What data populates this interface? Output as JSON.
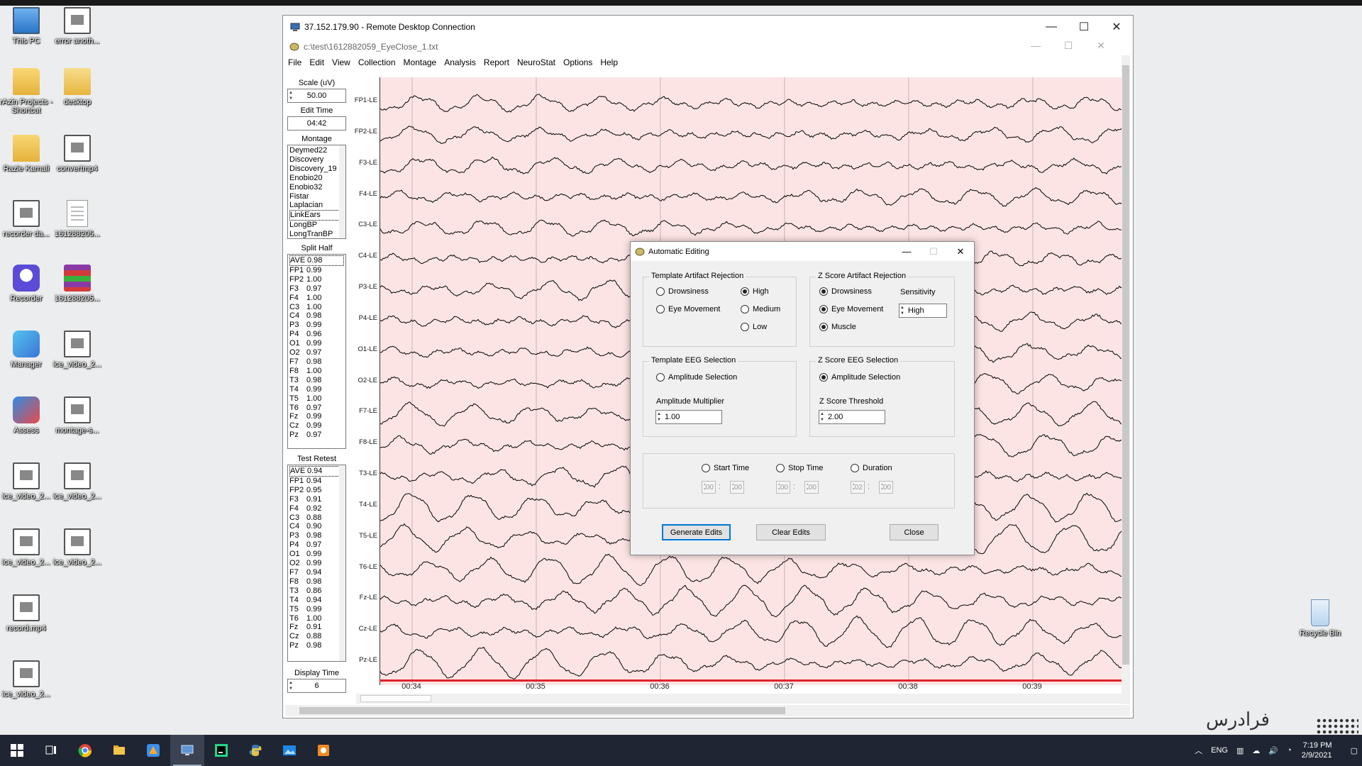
{
  "desktop": {
    "icons": [
      {
        "label": "This PC",
        "type": "pc"
      },
      {
        "label": "error anoth...",
        "type": "video"
      },
      {
        "label": "rAzin Projects - Shortcut",
        "type": "folder"
      },
      {
        "label": "desktop",
        "type": "folder2"
      },
      {
        "label": "Razie Kamali",
        "type": "folder"
      },
      {
        "label": "convertmp4",
        "type": "video"
      },
      {
        "label": "recorder da...",
        "type": "video"
      },
      {
        "label": "161288205...",
        "type": "doc"
      },
      {
        "label": "Recorder",
        "type": "rec"
      },
      {
        "label": "161288205...",
        "type": "winrar"
      },
      {
        "label": "Manager",
        "type": "mgr"
      },
      {
        "label": "ice_video_2...",
        "type": "video"
      },
      {
        "label": "Assess",
        "type": "assess"
      },
      {
        "label": "montage-s...",
        "type": "video"
      },
      {
        "label": "ice_video_2...",
        "type": "video"
      },
      {
        "label": "ice_video_2...",
        "type": "video"
      },
      {
        "label": "ice_video_2...",
        "type": "video"
      },
      {
        "label": "ice_video_2...",
        "type": "video"
      },
      {
        "label": "record.mp4",
        "type": "video"
      },
      {
        "label": "ice_video_2...",
        "type": "video"
      }
    ],
    "recycle_bin": "Recycle Bin"
  },
  "rdp": {
    "title": "37.152.179.90 - Remote Desktop Connection",
    "minimize": "—",
    "maximize": "☐",
    "close": "✕"
  },
  "app": {
    "title": "c:\\test\\1612882059_EyeClose_1.txt",
    "menu": [
      "File",
      "Edit",
      "View",
      "Collection",
      "Montage",
      "Analysis",
      "Report",
      "NeuroStat",
      "Options",
      "Help"
    ],
    "scale_label": "Scale (uV)",
    "scale_value": "50.00",
    "edit_time_label": "Edit Time",
    "edit_time_value": "04:42",
    "montage_label": "Montage",
    "montages": [
      "Deymed22",
      "Discovery",
      "Discovery_19",
      "Enobio20",
      "Enobio32",
      "Fistar",
      "Laplacian",
      "LinkEars",
      "LongBP",
      "LongTranBP"
    ],
    "montage_selected": "LinkEars",
    "split_half_label": "Split Half",
    "split_half": [
      [
        "AVE",
        "0.98"
      ],
      [
        "FP1",
        "0.99"
      ],
      [
        "FP2",
        "1.00"
      ],
      [
        "F3",
        "0.97"
      ],
      [
        "F4",
        "1.00"
      ],
      [
        "C3",
        "1.00"
      ],
      [
        "C4",
        "0.98"
      ],
      [
        "P3",
        "0.99"
      ],
      [
        "P4",
        "0.96"
      ],
      [
        "O1",
        "0.99"
      ],
      [
        "O2",
        "0.97"
      ],
      [
        "F7",
        "0.98"
      ],
      [
        "F8",
        "1.00"
      ],
      [
        "T3",
        "0.98"
      ],
      [
        "T4",
        "0.99"
      ],
      [
        "T5",
        "1.00"
      ],
      [
        "T6",
        "0.97"
      ],
      [
        "Fz",
        "0.99"
      ],
      [
        "Cz",
        "0.99"
      ],
      [
        "Pz",
        "0.97"
      ]
    ],
    "test_retest_label": "Test Retest",
    "test_retest": [
      [
        "AVE",
        "0.94"
      ],
      [
        "FP1",
        "0.94"
      ],
      [
        "FP2",
        "0.95"
      ],
      [
        "F3",
        "0.91"
      ],
      [
        "F4",
        "0.92"
      ],
      [
        "C3",
        "0.88"
      ],
      [
        "C4",
        "0.90"
      ],
      [
        "P3",
        "0.98"
      ],
      [
        "P4",
        "0.97"
      ],
      [
        "O1",
        "0.99"
      ],
      [
        "O2",
        "0.99"
      ],
      [
        "F7",
        "0.94"
      ],
      [
        "F8",
        "0.98"
      ],
      [
        "T3",
        "0.86"
      ],
      [
        "T4",
        "0.94"
      ],
      [
        "T5",
        "0.99"
      ],
      [
        "T6",
        "1.00"
      ],
      [
        "Fz",
        "0.91"
      ],
      [
        "Cz",
        "0.88"
      ],
      [
        "Pz",
        "0.98"
      ]
    ],
    "display_time_label": "Display Time",
    "display_time_value": "6",
    "channels": [
      "FP1-LE",
      "FP2-LE",
      "F3-LE",
      "F4-LE",
      "C3-LE",
      "C4-LE",
      "P3-LE",
      "P4-LE",
      "O1-LE",
      "O2-LE",
      "F7-LE",
      "F8-LE",
      "T3-LE",
      "T4-LE",
      "T5-LE",
      "T6-LE",
      "Fz-LE",
      "Cz-LE",
      "Pz-LE"
    ],
    "time_ticks": [
      "00:34",
      "00:35",
      "00:36",
      "00:37",
      "00:38",
      "00:39"
    ],
    "colors": {
      "eeg_bg": "#fde4e4",
      "trace": "#000000",
      "marker": "#e0232b",
      "accent": "#0078d7"
    }
  },
  "dialog": {
    "title": "Automatic Editing",
    "template_artifact": {
      "label": "Template Artifact Rejection",
      "drowsiness": "Drowsiness",
      "eye_movement": "Eye Movement",
      "high": "High",
      "medium": "Medium",
      "low": "Low"
    },
    "z_artifact": {
      "label": "Z Score Artifact Rejection",
      "drowsiness": "Drowsiness",
      "eye_movement": "Eye Movement",
      "muscle": "Muscle",
      "sensitivity_label": "Sensitivity",
      "sensitivity_value": "High"
    },
    "template_eeg": {
      "label": "Template EEG Selection",
      "amplitude_selection": "Amplitude Selection",
      "multiplier_label": "Amplitude Multiplier",
      "multiplier_value": "1.00"
    },
    "z_eeg": {
      "label": "Z Score EEG Selection",
      "amplitude_selection": "Amplitude Selection",
      "threshold_label": "Z Score Threshold",
      "threshold_value": "2.00"
    },
    "times": {
      "start_label": "Start Time",
      "stop_label": "Stop Time",
      "duration_label": "Duration",
      "start": [
        "00",
        "00"
      ],
      "stop": [
        "00",
        "00"
      ],
      "duration": [
        "02",
        "00"
      ],
      "sep": ":"
    },
    "buttons": {
      "generate": "Generate Edits",
      "clear": "Clear Edits",
      "close": "Close"
    }
  },
  "taskbar": {
    "tray_lang": "ENG",
    "time": "7:19 PM",
    "date": "2/9/2021"
  },
  "watermark": "فرادرس"
}
